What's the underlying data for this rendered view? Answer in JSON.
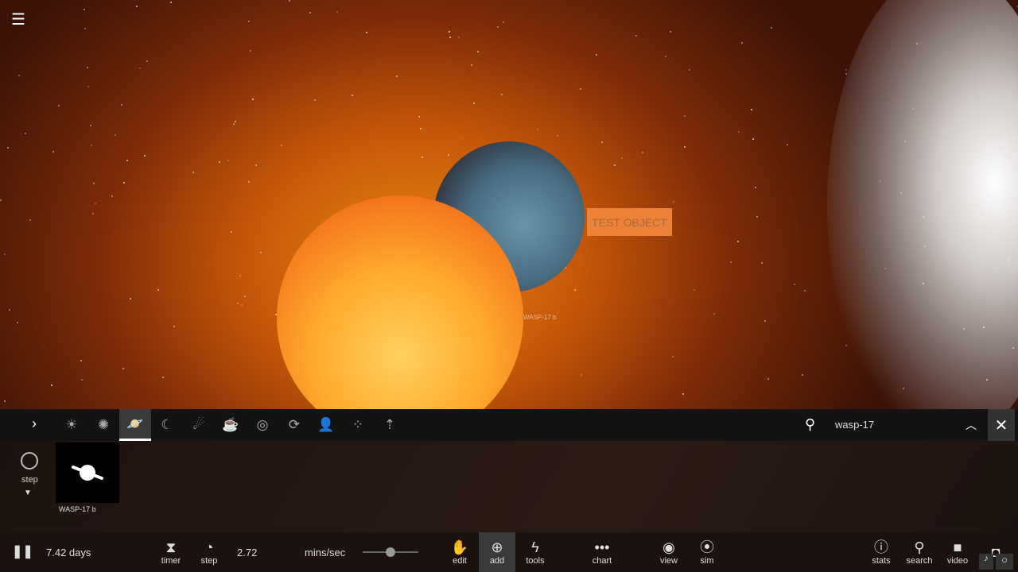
{
  "scene": {
    "test_object_label": "TEST OBJECT",
    "object_label": "WASP-17 b"
  },
  "toolbar": {
    "expand_icon": "chevron-right-icon",
    "categories": [
      {
        "name": "planetary-systems",
        "glyph": "☀"
      },
      {
        "name": "stars",
        "glyph": "✺"
      },
      {
        "name": "planets",
        "glyph": "🪐",
        "selected": true
      },
      {
        "name": "moons",
        "glyph": "☾"
      },
      {
        "name": "comets",
        "glyph": "☄"
      },
      {
        "name": "fun-objects",
        "glyph": "☕"
      },
      {
        "name": "galaxies",
        "glyph": "◎"
      },
      {
        "name": "black-holes",
        "glyph": "⟳"
      },
      {
        "name": "saved-objects",
        "glyph": "👤"
      },
      {
        "name": "star-clusters",
        "glyph": "⁘"
      },
      {
        "name": "upload",
        "glyph": "⇡"
      }
    ],
    "search_value": "wasp-17"
  },
  "panel": {
    "step_label": "step",
    "result_label": "WASP-17 b"
  },
  "bottom": {
    "time": "7.42 days",
    "timer": "timer",
    "step": "step",
    "rate": "2.72",
    "rate_unit": "mins/sec",
    "slider_value": 0.5,
    "edit": "edit",
    "add": "add",
    "tools": "tools",
    "chart": "chart",
    "view": "view",
    "sim": "sim",
    "stats": "stats",
    "search": "search",
    "video": "video"
  }
}
